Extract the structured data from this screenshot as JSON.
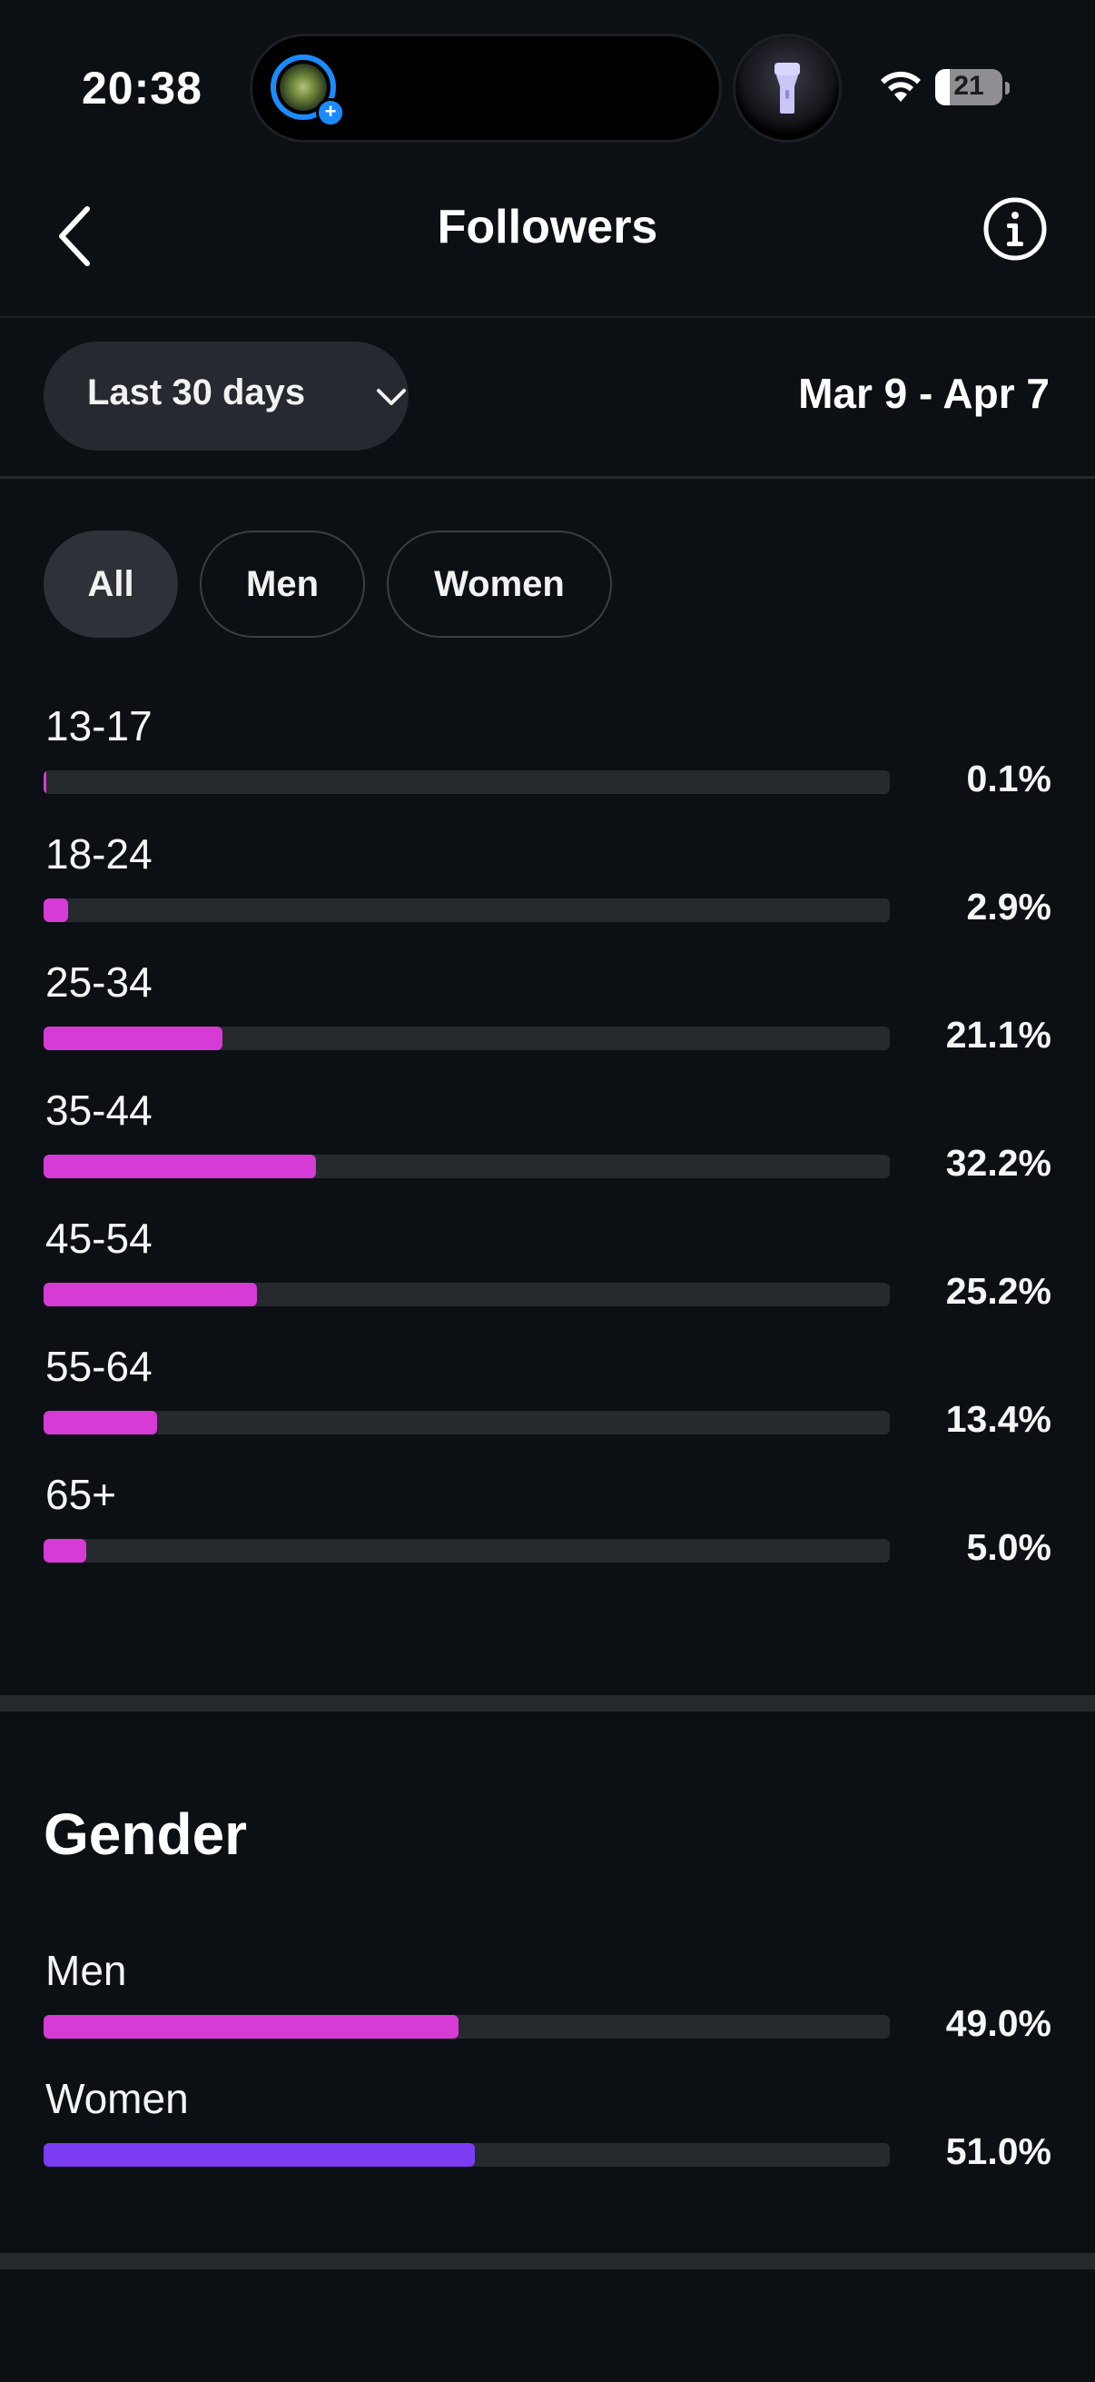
{
  "status_bar": {
    "time": "20:38",
    "battery": "21",
    "battery_level": 0.21,
    "icons": [
      "app-avatar-icon",
      "flashlight-icon",
      "wifi-icon",
      "battery-icon"
    ]
  },
  "header": {
    "title": "Followers",
    "back_icon": "chevron-left-icon",
    "info_icon": "info-icon"
  },
  "date_filter": {
    "selected_range": "Last 30 days",
    "range_icon": "chevron-down-icon",
    "date_range": "Mar 9 - Apr 7"
  },
  "segment_tabs": {
    "selected": "All",
    "options": [
      "All",
      "Men",
      "Women"
    ]
  },
  "age_ranges": [
    {
      "label": "13-17",
      "value": "0.1%",
      "percent": 0.1
    },
    {
      "label": "18-24",
      "value": "2.9%",
      "percent": 2.9
    },
    {
      "label": "25-34",
      "value": "21.1%",
      "percent": 21.1
    },
    {
      "label": "35-44",
      "value": "32.2%",
      "percent": 32.2
    },
    {
      "label": "45-54",
      "value": "25.2%",
      "percent": 25.2
    },
    {
      "label": "55-64",
      "value": "13.4%",
      "percent": 13.4
    },
    {
      "label": "65+",
      "value": "5.0%",
      "percent": 5.0
    }
  ],
  "gender": {
    "title": "Gender",
    "items": [
      {
        "label": "Men",
        "value": "49.0%",
        "percent": 49.0
      },
      {
        "label": "Women",
        "value": "51.0%",
        "percent": 51.0
      }
    ]
  },
  "colors": {
    "background": "#0c1014",
    "age_bar": "#d63bd6",
    "men_bar": "#d63bd6",
    "women_bar": "#7b3cf2",
    "track": "#26292e",
    "accent_blue": "#1a8cff"
  }
}
